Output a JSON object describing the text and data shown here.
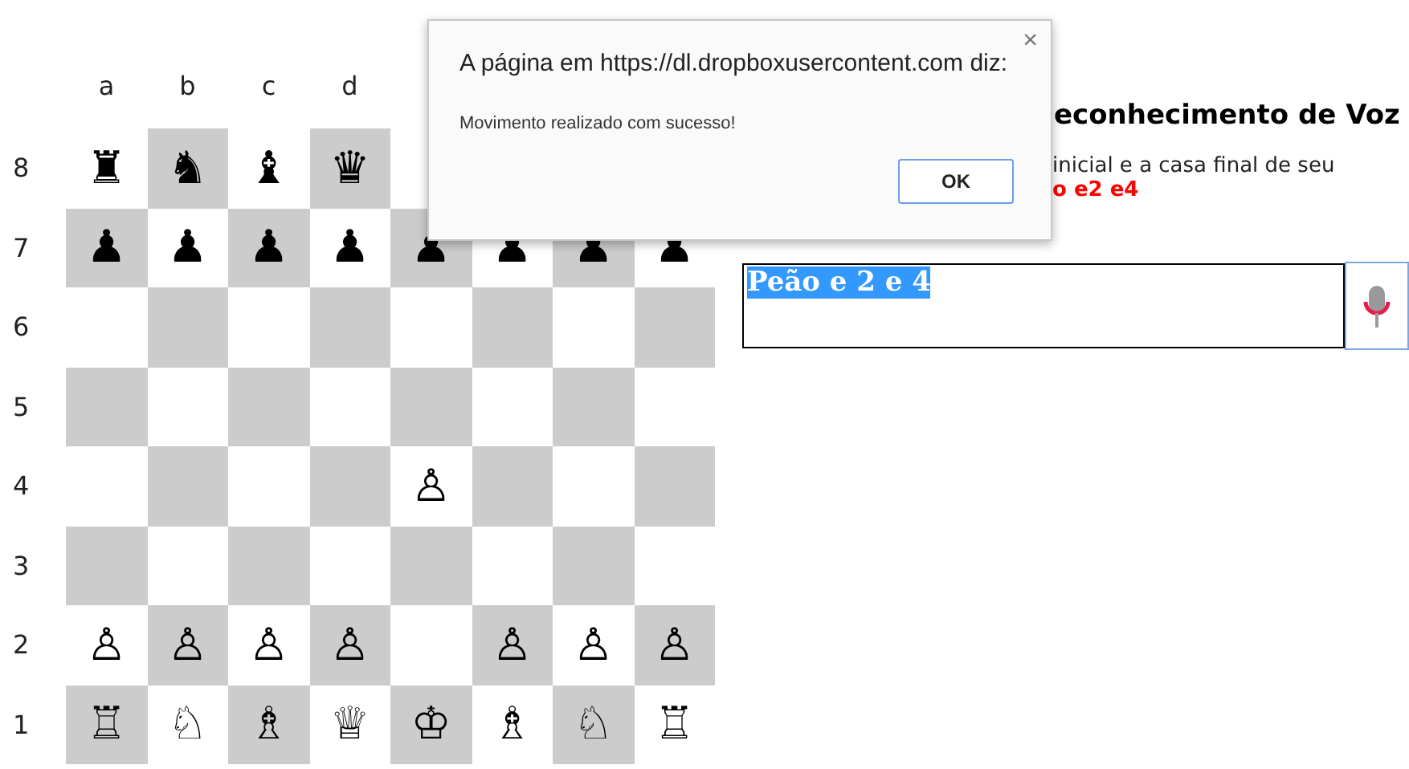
{
  "board": {
    "files": [
      "a",
      "b",
      "c",
      "d"
    ],
    "ranks": [
      {
        "label": "8",
        "cells": [
          "♜",
          "♞",
          "♝",
          "♛",
          null,
          null,
          null,
          null
        ]
      },
      {
        "label": "7",
        "cells": [
          "♟",
          "♟",
          "♟",
          "♟",
          "♟",
          "♟",
          "♟",
          "♟"
        ]
      },
      {
        "label": "6",
        "cells": [
          null,
          null,
          null,
          null,
          null,
          null,
          null,
          null
        ]
      },
      {
        "label": "5",
        "cells": [
          null,
          null,
          null,
          null,
          null,
          null,
          null,
          null
        ]
      },
      {
        "label": "4",
        "cells": [
          null,
          null,
          null,
          null,
          "♙",
          null,
          null,
          null
        ]
      },
      {
        "label": "3",
        "cells": [
          null,
          null,
          null,
          null,
          null,
          null,
          null,
          null
        ]
      },
      {
        "label": "2",
        "cells": [
          "♙",
          "♙",
          "♙",
          "♙",
          null,
          "♙",
          "♙",
          "♙"
        ]
      },
      {
        "label": "1",
        "cells": [
          "♖",
          "♘",
          "♗",
          "♕",
          "♔",
          "♗",
          "♘",
          "♖"
        ]
      }
    ]
  },
  "panel": {
    "heading": "econhecimento de Voz",
    "instruction": "inicial e a casa final de seu",
    "example": "o e2 e4",
    "input": {
      "value": "Peão e 2 e 4",
      "selected": true
    }
  },
  "dialog": {
    "title": "A página em https://dl.dropboxusercontent.com diz:",
    "message": "Movimento realizado com sucesso!",
    "close": "×",
    "button": "OK"
  }
}
